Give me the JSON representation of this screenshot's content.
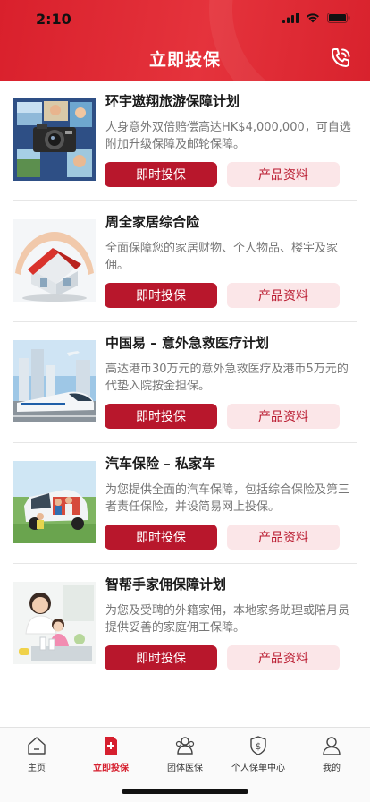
{
  "status_bar": {
    "time": "2:10"
  },
  "header": {
    "title": "立即投保"
  },
  "products": [
    {
      "title": "环宇遨翔旅游保障计划",
      "description": "人身意外双倍赔偿高达HK$4,000,000，可自选附加升级保障及邮轮保障。",
      "buy_label": "即时投保",
      "info_label": "产品资料"
    },
    {
      "title": "周全家居综合险",
      "description": "全面保障您的家居财物、个人物品、楼宇及家佣。",
      "buy_label": "即时投保",
      "info_label": "产品资料"
    },
    {
      "title": "中国易 – 意外急救医疗计划",
      "description": "高达港币30万元的意外急救医疗及港币5万元的代垫入院按金担保。",
      "buy_label": "即时投保",
      "info_label": "产品资料"
    },
    {
      "title": "汽车保险 – 私家车",
      "description": "为您提供全面的汽车保障，包括综合保险及第三者责任保险，并设简易网上投保。",
      "buy_label": "即时投保",
      "info_label": "产品资料"
    },
    {
      "title": "智帮手家佣保障计划",
      "description": "为您及受聘的外籍家佣，本地家务助理或陪月员提供妥善的家庭佣工保障。",
      "buy_label": "即时投保",
      "info_label": "产品资料"
    }
  ],
  "tabbar": {
    "items": [
      {
        "label": "主页",
        "icon": "home-icon"
      },
      {
        "label": "立即投保",
        "icon": "document-plus-icon",
        "active": true
      },
      {
        "label": "团体医保",
        "icon": "group-icon"
      },
      {
        "label": "个人保单中心",
        "icon": "shield-dollar-icon"
      },
      {
        "label": "我的",
        "icon": "person-icon"
      }
    ]
  },
  "colors": {
    "brand_red": "#d61f2e",
    "button_red": "#b8172c",
    "button_pink": "#fbe6e8"
  }
}
